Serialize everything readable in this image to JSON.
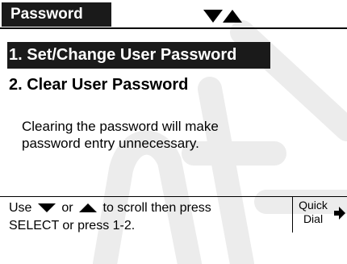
{
  "header": {
    "title": "Password"
  },
  "menu": {
    "items": [
      {
        "label": "1. Set/Change User Password",
        "selected": true
      },
      {
        "label": "2. Clear User Password",
        "selected": false
      }
    ]
  },
  "description": {
    "line1": "Clearing the password will make",
    "line2": "password entry unnecessary."
  },
  "footer": {
    "instruction": {
      "use": "Use",
      "or": "or",
      "scroll_then": "to scroll then press",
      "line2": "SELECT or press 1-2."
    },
    "softkey": {
      "line1": "Quick",
      "line2": "Dial",
      "icon": "arrow-right-icon"
    }
  },
  "icons": {
    "scroll_down": "triangle-down-icon",
    "scroll_up": "triangle-up-icon"
  },
  "colors": {
    "highlight_bg": "#1a1a1a",
    "highlight_text": "#ffffff",
    "watermark": "#e6e6e6"
  }
}
